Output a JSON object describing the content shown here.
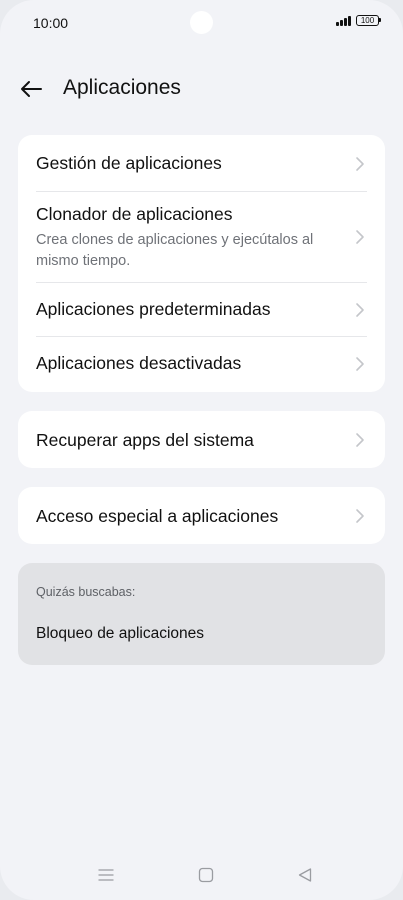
{
  "status_bar": {
    "time": "10:00",
    "battery": "100",
    "signal_icon": "signal-bars-icon",
    "battery_icon": "battery-icon"
  },
  "header": {
    "back_icon": "arrow-left-icon",
    "title": "Aplicaciones"
  },
  "main_list": {
    "items": [
      {
        "title": "Gestión de aplicaciones",
        "subtitle": ""
      },
      {
        "title": "Clonador de aplicaciones",
        "subtitle": "Crea clones de aplicaciones y ejecútalos al mismo tiempo."
      },
      {
        "title": "Aplicaciones predeterminadas",
        "subtitle": ""
      },
      {
        "title": "Aplicaciones desactivadas",
        "subtitle": ""
      }
    ]
  },
  "recover": {
    "title": "Recuperar apps del sistema"
  },
  "special_access": {
    "title": "Acceso especial a aplicaciones"
  },
  "suggestion": {
    "label": "Quizás buscabas:",
    "link": "Bloqueo de aplicaciones"
  },
  "nav": {
    "menu_icon": "menu-icon",
    "home_icon": "home-icon",
    "back_icon": "back-triangle-icon"
  },
  "colors": {
    "background": "#f2f3f7",
    "card": "#ffffff",
    "suggestion_card": "#e1e2e5",
    "secondary_text": "#6f7278",
    "chevron": "#c4c6ca"
  }
}
